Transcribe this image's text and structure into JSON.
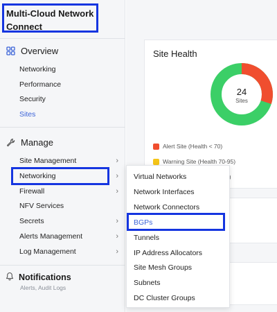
{
  "app": {
    "title": "Multi-Cloud Network Connect"
  },
  "overview": {
    "label": "Overview",
    "items": [
      {
        "label": "Networking"
      },
      {
        "label": "Performance"
      },
      {
        "label": "Security"
      },
      {
        "label": "Sites"
      }
    ]
  },
  "manage": {
    "label": "Manage",
    "items": [
      {
        "label": "Site Management",
        "has_children": true
      },
      {
        "label": "Networking",
        "has_children": true
      },
      {
        "label": "Firewall",
        "has_children": true
      },
      {
        "label": "NFV Services",
        "has_children": false
      },
      {
        "label": "Secrets",
        "has_children": true
      },
      {
        "label": "Alerts Management",
        "has_children": true
      },
      {
        "label": "Log Management",
        "has_children": true
      }
    ]
  },
  "notifications": {
    "label": "Notifications",
    "sub": "Alerts, Audit Logs"
  },
  "site_health": {
    "title": "Site Health",
    "total": "24",
    "unit": "Sites",
    "legend": [
      {
        "label": "Alert Site (Health < 70)",
        "color": "#f04e2f"
      },
      {
        "label": "Warning Site (Health 70-95)",
        "color": "#f5c518"
      },
      {
        "label": "5)",
        "color": ""
      }
    ],
    "segments": [
      {
        "name": "alert",
        "fraction": 0.3,
        "color": "#f04e2f"
      },
      {
        "name": "healthy",
        "fraction": 0.7,
        "color": "#3bcf67"
      }
    ]
  },
  "networking_submenu": {
    "items": [
      {
        "label": "Virtual Networks"
      },
      {
        "label": "Network Interfaces"
      },
      {
        "label": "Network Connectors"
      },
      {
        "label": "BGPs"
      },
      {
        "label": "Tunnels"
      },
      {
        "label": "IP Address Allocators"
      },
      {
        "label": "Site Mesh Groups"
      },
      {
        "label": "Subnets"
      },
      {
        "label": "DC Cluster Groups"
      }
    ]
  },
  "colors": {
    "accent": "#3b63d8",
    "highlight_border": "#1535e0"
  }
}
